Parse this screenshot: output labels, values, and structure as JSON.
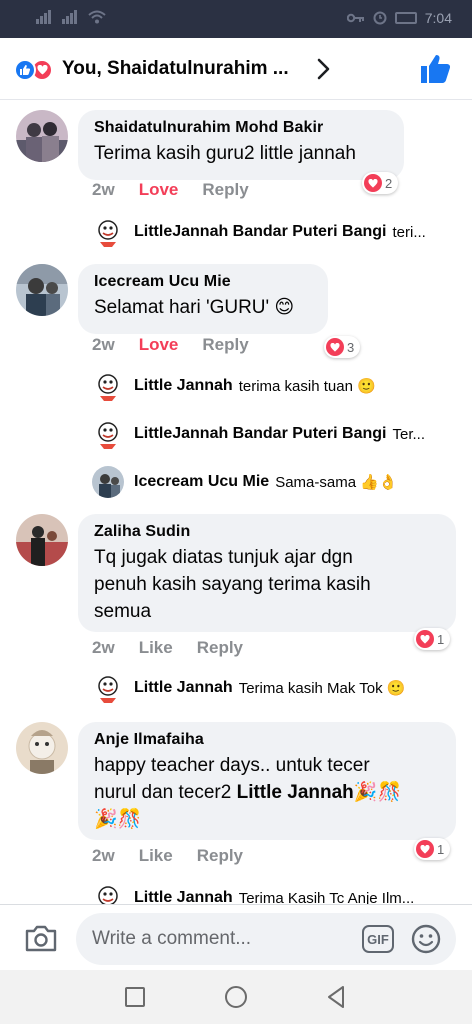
{
  "status_bar": {
    "time": "7:04"
  },
  "header": {
    "title": "You, Shaidatulnurahim ..."
  },
  "comments": [
    {
      "name": "Shaidatulnurahim Mohd Bakir",
      "lines": [
        "Terima kasih guru2 little jannah"
      ],
      "time": "2w",
      "action": "Love",
      "reply": "Reply",
      "reaction_count": "2",
      "replies": [
        {
          "name": "LittleJannah Bandar Puteri Bangi",
          "text": "teri..."
        }
      ]
    },
    {
      "name": "Icecream Ucu Mie",
      "lines": [
        "Selamat hari 'GURU' 😊"
      ],
      "time": "2w",
      "action": "Love",
      "reply": "Reply",
      "reaction_count": "3",
      "replies": [
        {
          "name": "Little Jannah",
          "text": "terima kasih tuan 🙂"
        },
        {
          "name": "LittleJannah Bandar Puteri Bangi",
          "text": "Ter..."
        },
        {
          "name": "Icecream Ucu Mie",
          "text": "Sama-sama 👍👌"
        }
      ]
    },
    {
      "name": "Zaliha Sudin",
      "lines": [
        "Tq jugak diatas tunjuk ajar  dgn",
        "penuh kasih sayang  terima  kasih",
        "semua"
      ],
      "time": "2w",
      "action": "Like",
      "reply": "Reply",
      "reaction_count": "1",
      "replies": [
        {
          "name": "Little Jannah",
          "text": "Terima kasih Mak Tok 🙂"
        }
      ]
    },
    {
      "name": "Anje Ilmafaiha",
      "line1": "happy teacher days.. untuk tecer",
      "line2_pre": "nurul dan tecer2 ",
      "line2_bold": "Little Jannah",
      "line2_post": "🎉🎊",
      "line3": "🎉🎊",
      "time": "2w",
      "action": "Like",
      "reply": "Reply",
      "reaction_count": "1",
      "replies": [
        {
          "name": "Little Jannah",
          "text": "Terima Kasih Tc Anje Ilm..."
        }
      ]
    }
  ],
  "composer": {
    "placeholder": "Write a comment...",
    "gif_label": "GIF"
  },
  "colors": {
    "facebook_blue": "#1877f2",
    "love_red": "#f33e58",
    "bubble_gray": "#f0f2f5",
    "meta_gray": "#8a8d91"
  },
  "icons": [
    "like-icon",
    "love-icon",
    "chevron-right-icon",
    "thumbs-up-icon",
    "camera-icon",
    "gif-icon",
    "emoji-icon",
    "heart-icon"
  ]
}
